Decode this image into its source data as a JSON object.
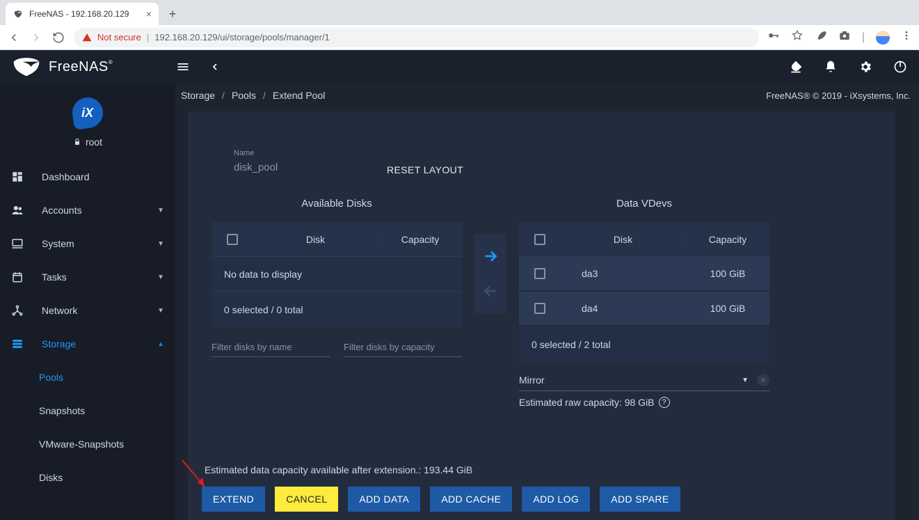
{
  "browser": {
    "tab_title": "FreeNAS - 192.168.20.129",
    "not_secure": "Not secure",
    "url": "192.168.20.129/ui/storage/pools/manager/1"
  },
  "topbar": {
    "brand": "FreeNAS"
  },
  "sidebar": {
    "ix_text": "iX",
    "user": "root",
    "items": [
      {
        "label": "Dashboard"
      },
      {
        "label": "Accounts"
      },
      {
        "label": "System"
      },
      {
        "label": "Tasks"
      },
      {
        "label": "Network"
      },
      {
        "label": "Storage"
      }
    ],
    "storage_children": [
      {
        "label": "Pools"
      },
      {
        "label": "Snapshots"
      },
      {
        "label": "VMware-Snapshots"
      },
      {
        "label": "Disks"
      }
    ]
  },
  "breadcrumb": {
    "a": "Storage",
    "b": "Pools",
    "c": "Extend Pool",
    "copyright": "FreeNAS® © 2019 - iXsystems, Inc."
  },
  "form": {
    "name_label": "Name",
    "name_value": "disk_pool",
    "reset_layout": "RESET LAYOUT",
    "available_title": "Available Disks",
    "vdevs_title": "Data VDevs",
    "col_disk": "Disk",
    "col_capacity": "Capacity",
    "no_data": "No data to display",
    "avail_footer": "0 selected / 0 total",
    "vdev_rows": [
      {
        "disk": "da3",
        "capacity": "100 GiB"
      },
      {
        "disk": "da4",
        "capacity": "100 GiB"
      }
    ],
    "vdev_footer": "0 selected / 2 total",
    "filter_name_ph": "Filter disks by name",
    "filter_cap_ph": "Filter disks by capacity",
    "vdev_type": "Mirror",
    "est_raw": "Estimated raw capacity: 98 GiB",
    "est_total": "Estimated data capacity available after extension.: 193.44 GiB",
    "buttons": {
      "extend": "EXTEND",
      "cancel": "CANCEL",
      "add_data": "ADD DATA",
      "add_cache": "ADD CACHE",
      "add_log": "ADD LOG",
      "add_spare": "ADD SPARE"
    }
  }
}
